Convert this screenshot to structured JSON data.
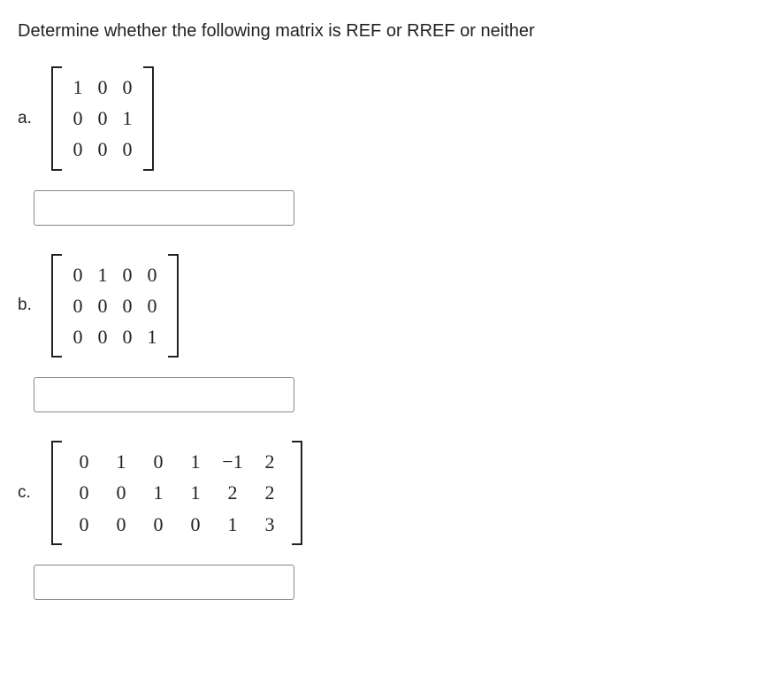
{
  "question_text": "Determine whether the following matrix is REF or RREF or neither",
  "problems": [
    {
      "label": "a.",
      "cols": 3,
      "cells": [
        "1",
        "0",
        "0",
        "0",
        "0",
        "1",
        "0",
        "0",
        "0"
      ],
      "answer": "",
      "wide": false
    },
    {
      "label": "b.",
      "cols": 4,
      "cells": [
        "0",
        "1",
        "0",
        "0",
        "0",
        "0",
        "0",
        "0",
        "0",
        "0",
        "0",
        "1"
      ],
      "answer": "",
      "wide": false
    },
    {
      "label": "c.",
      "cols": 6,
      "cells": [
        "0",
        "1",
        "0",
        "1",
        "−1",
        "2",
        "0",
        "0",
        "1",
        "1",
        "2",
        "2",
        "0",
        "0",
        "0",
        "0",
        "1",
        "3"
      ],
      "answer": "",
      "wide": true
    }
  ]
}
